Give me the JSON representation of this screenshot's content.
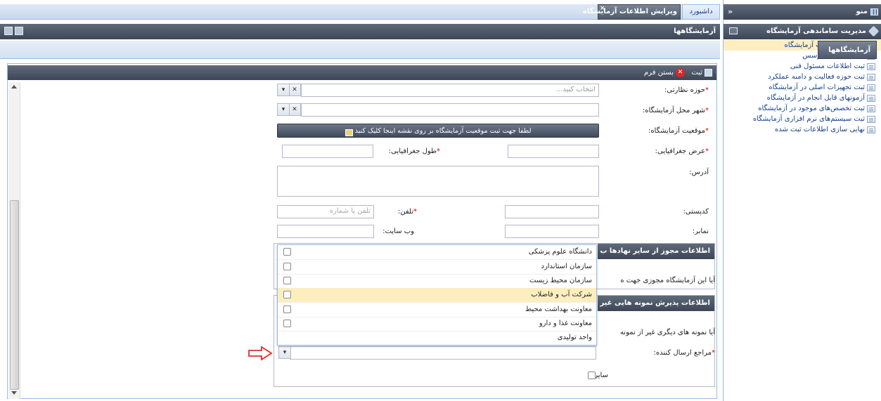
{
  "sidebar": {
    "menu_label": "منو",
    "section_title": "مدیریت ساماندهی آزمایشگاه",
    "items": [
      "ویرایش اطلاعات آزمایشگاه",
      "ثبت اطلاعات موسس",
      "ثبت اطلاعات مسئول فنی",
      "ثبت حوزه فعالیت و دامنه عملکرد",
      "ثبت تجهیزات اصلی در آزمایشگاه",
      "آزمونهای قابل انجام در آزمایشگاه",
      "ثبت تخصص‌های موجود در آزمایشگاه",
      "ثبت سیستم‌های نرم افزاری آزمایشگاه",
      "نهایی سازی اطلاعات ثبت شده"
    ]
  },
  "tabs": {
    "dashboard": "داشبورد",
    "active": "ویرایش اطلاعات آزمایشگاه"
  },
  "panel": {
    "title": "آزمایشگاهها",
    "subtab": "آزمایشگاهها"
  },
  "toolbar": {
    "save": "ثبت",
    "close": "بستن فرم"
  },
  "form": {
    "supervision_label": "حوزه نظارتی:",
    "supervision_placeholder": "انتخاب کنید...",
    "city_label": "شهر محل آزمایشگاه:",
    "location_label": "موقعیت آزمایشگاه:",
    "map_button": "لطفا جهت ثبت موقعیت آزمایشگاه بر روی نقشه اینجا کلیک کنید",
    "lat_label": "عرض جغرافیایی:",
    "lng_label": "طول جغرافیایی:",
    "address_label": "آدرس:",
    "postal_label": "کدپستی:",
    "phone_label": "تلفن:",
    "phone_placeholder": "تلفن یا شماره",
    "fax_label": "نمابر:",
    "website_label": "وب سایت:",
    "license_section": "اطلاعات مجوز از سایر نهادها ب",
    "license_question": "آیا این آزمایشگاه مجوزی جهت ه",
    "samples_section": "اطلاعات پذیرش نمونه هایی غیر",
    "samples_question": "آیا نمونه های دیگری غیر از نمونه",
    "senders_label": "مراجع ارسال کننده:",
    "other_label": "سایر:"
  },
  "dropdown_options": [
    "دانشگاه علوم پزشکی",
    "سازمان استاندارد",
    "سازمان محیط زیست",
    "شرکت آب و فاضلاب",
    "معاونت بهداشت محیط",
    "معاونت غذا و دارو",
    "واحد تولیدی"
  ],
  "colors": {
    "header_dark": "#4a5566",
    "highlight": "#fdeec0",
    "accent_blue": "#15428b",
    "arrow_red": "#e0302a"
  }
}
